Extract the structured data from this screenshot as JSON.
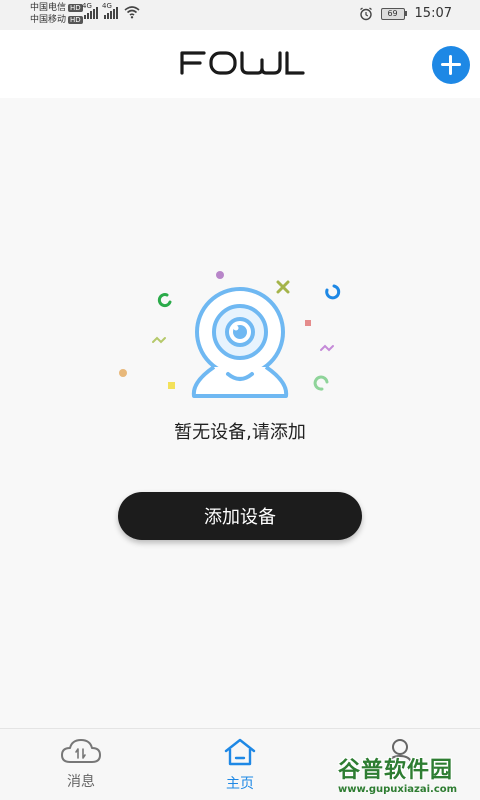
{
  "status_bar": {
    "carrier1": "中国电信",
    "carrier2": "中国移动",
    "hd": "HD",
    "signal_gen": "4G",
    "battery": "69",
    "time": "15:07"
  },
  "header": {
    "logo": "FOWL",
    "add_button_icon": "plus-icon",
    "accent_color": "#1e88e5"
  },
  "main": {
    "empty_message": "暂无设备,请添加",
    "add_device_button": "添加设备",
    "illustration_icon": "webcam-icon"
  },
  "bottom_nav": {
    "items": [
      {
        "label": "消息",
        "icon": "cloud-icon",
        "active": false
      },
      {
        "label": "主页",
        "icon": "home-icon",
        "active": true
      },
      {
        "label": "",
        "icon": "user-icon",
        "active": false
      }
    ]
  },
  "watermark": {
    "title": "谷普软件园",
    "url": "www.gupuxiazai.com"
  }
}
